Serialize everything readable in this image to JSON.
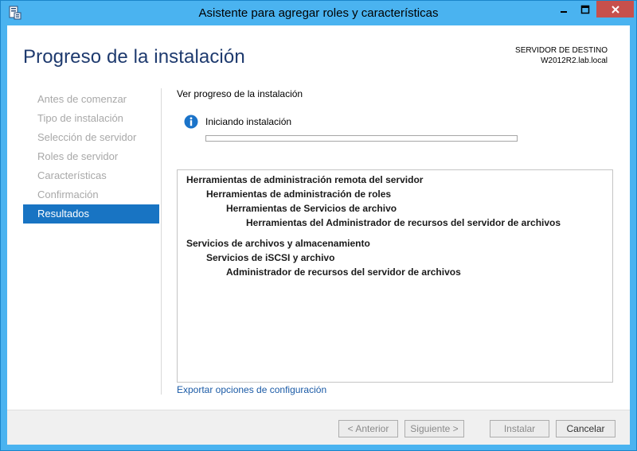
{
  "window": {
    "title": "Asistente para agregar roles y características"
  },
  "header": {
    "page_title": "Progreso de la instalación",
    "destination_label": "SERVIDOR DE DESTINO",
    "destination_server": "W2012R2.lab.local"
  },
  "nav": {
    "items": [
      {
        "label": "Antes de comenzar"
      },
      {
        "label": "Tipo de instalación"
      },
      {
        "label": "Selección de servidor"
      },
      {
        "label": "Roles de servidor"
      },
      {
        "label": "Características"
      },
      {
        "label": "Confirmación"
      },
      {
        "label": "Resultados"
      }
    ],
    "active_index": 6
  },
  "main": {
    "section_title": "Ver progreso de la instalación",
    "status": "Iniciando instalación",
    "progress": 0,
    "results": [
      {
        "label": "Herramientas de administración remota del servidor",
        "level": 0
      },
      {
        "label": "Herramientas de administración de roles",
        "level": 1
      },
      {
        "label": "Herramientas de Servicios de archivo",
        "level": 2
      },
      {
        "label": "Herramientas del Administrador de recursos del servidor de archivos",
        "level": 3
      },
      {
        "label": "Servicios de archivos y almacenamiento",
        "level": 0
      },
      {
        "label": "Servicios de iSCSI y archivo",
        "level": 1
      },
      {
        "label": "Administrador de recursos del servidor de archivos",
        "level": 2
      }
    ],
    "export_link": "Exportar opciones de configuración"
  },
  "footer": {
    "prev_label": "< Anterior",
    "next_label": "Siguiente >",
    "install_label": "Instalar",
    "cancel_label": "Cancelar"
  },
  "icons": {
    "app": "server-manager-icon",
    "info": "info-icon",
    "minimize": "minimize-icon",
    "maximize": "maximize-icon",
    "close": "close-icon"
  },
  "colors": {
    "titlebar": "#4ab3f0",
    "close_button": "#c7504c",
    "heading": "#1e3a6e",
    "nav_active": "#1874c3",
    "link": "#1a5aa6",
    "info": "#1a73c9"
  }
}
